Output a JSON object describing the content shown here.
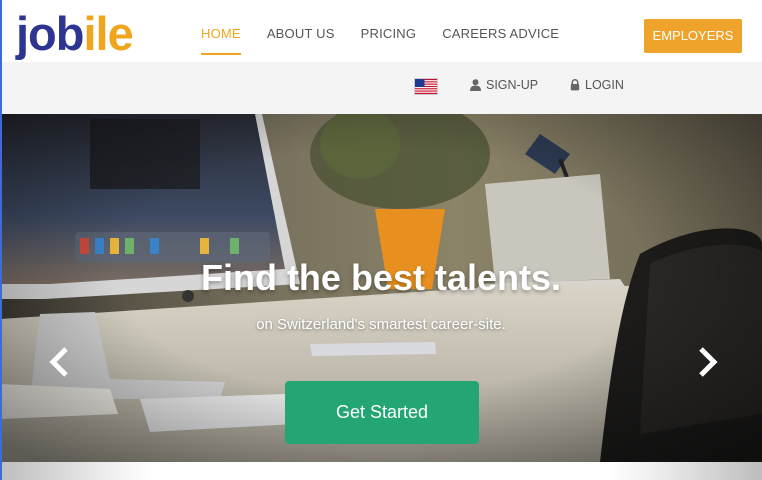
{
  "brand": {
    "part1": "job",
    "part2": "ile"
  },
  "nav": {
    "items": [
      {
        "label": "HOME",
        "active": true
      },
      {
        "label": "ABOUT US",
        "active": false
      },
      {
        "label": "PRICING",
        "active": false
      },
      {
        "label": "CAREERS ADVICE",
        "active": false
      }
    ],
    "employers_label": "EMPLOYERS"
  },
  "subbar": {
    "flag_icon": "us-flag-icon",
    "signup_label": "SIGN-UP",
    "login_label": "LOGIN"
  },
  "hero": {
    "title": "Find the best talents.",
    "subtitle": "on Switzerland's smartest career-site.",
    "cta_label": "Get Started"
  },
  "colors": {
    "brand_blue": "#2e3590",
    "accent_orange": "#f0a51f",
    "cta_green": "#23a574"
  }
}
